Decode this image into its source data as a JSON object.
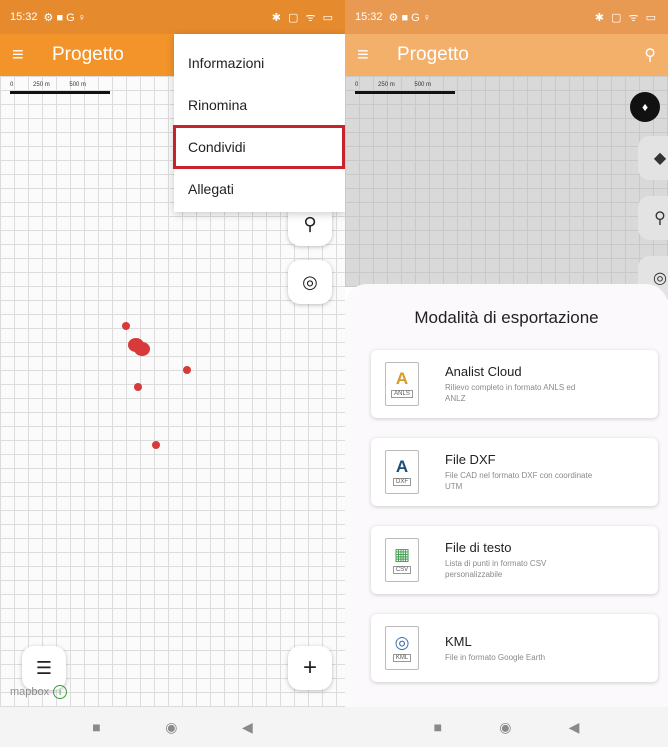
{
  "left": {
    "status": {
      "time": "15:32",
      "icons_left": "⚙ ■ G ♀",
      "icons_right": "✱ ▢ ᯤ ▭"
    },
    "appbar": {
      "title": "Progetto"
    },
    "scale": {
      "a": "0",
      "b": "250 m",
      "c": "500 m"
    },
    "menu": {
      "items": [
        "Informazioni",
        "Rinomina",
        "Condividi",
        "Allegati"
      ]
    },
    "mapbox": {
      "label": "mapbox",
      "info": "i"
    },
    "buttons": {
      "add": "+",
      "list": "☰"
    }
  },
  "right": {
    "status": {
      "time": "15:32",
      "icons_left": "⚙ ■ G ♀",
      "icons_right": "✱ ▢ ᯤ ▭"
    },
    "appbar": {
      "title": "Progetto"
    },
    "scale": {
      "a": "0",
      "b": "250 m",
      "c": "500 m"
    },
    "sheet": {
      "title": "Modalità di esportazione",
      "options": [
        {
          "name": "Analist Cloud",
          "desc": "Rilievo completo in formato ANLS ed ANLZ",
          "glyph": "A",
          "tag": "ANLS",
          "color": "#d79a2a"
        },
        {
          "name": "File DXF",
          "desc": "File CAD nel formato DXF con coordinate UTM",
          "glyph": "A",
          "tag": "DXF",
          "color": "#1d4f7a"
        },
        {
          "name": "File di testo",
          "desc": "Lista di punti in formato CSV personalizzabile",
          "glyph": "▦",
          "tag": "CSV",
          "color": "#3e9a4a"
        },
        {
          "name": "KML",
          "desc": "File in formato Google Earth",
          "glyph": "◎",
          "tag": "KML",
          "color": "#3a6fb0"
        }
      ]
    }
  },
  "navbar": {
    "square": "■",
    "circle": "◉",
    "back": "◀"
  }
}
